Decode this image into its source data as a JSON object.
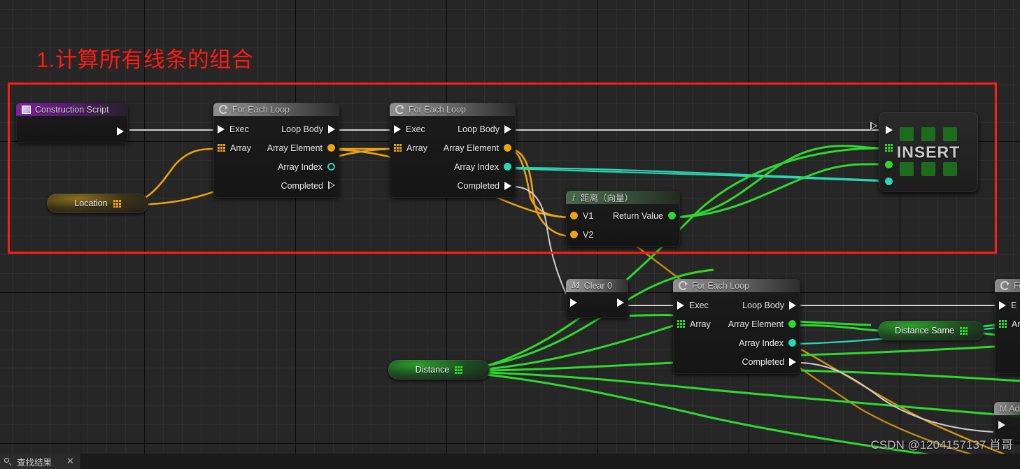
{
  "annotation": {
    "title": "1.计算所有线条的组合",
    "box_color": "#fe1b12"
  },
  "colors": {
    "exec_wire": "#cfcfcf",
    "vector_gold": "#e8a317",
    "float_green": "#2fd82f",
    "int_cyan": "#2bd6b4",
    "red_annotation": "#fe1b12",
    "event_purple": "#7b2399"
  },
  "nodes": {
    "construction_script": {
      "title": "Construction Script",
      "icon": "event-icon",
      "out_exec": ""
    },
    "for_each_loop_1": {
      "title": "For Each Loop",
      "icon": "loop-icon",
      "inputs": [
        {
          "label": "Exec",
          "pin": "exec-pin"
        },
        {
          "label": "Array",
          "pin": "array-pin",
          "color": "#e8a317"
        }
      ],
      "outputs": [
        {
          "label": "Loop Body",
          "pin": "exec-pin"
        },
        {
          "label": "Array Element",
          "pin": "circle-pin",
          "color": "#e8a317"
        },
        {
          "label": "Array Index",
          "pin": "circle-pin-hollow",
          "color": "#2bd6b4"
        },
        {
          "label": "Completed",
          "pin": "exec-pin-hollow"
        }
      ]
    },
    "for_each_loop_2": {
      "title": "For Each Loop",
      "icon": "loop-icon",
      "inputs": [
        {
          "label": "Exec",
          "pin": "exec-pin"
        },
        {
          "label": "Array",
          "pin": "array-pin",
          "color": "#e8a317"
        }
      ],
      "outputs": [
        {
          "label": "Loop Body",
          "pin": "exec-pin"
        },
        {
          "label": "Array Element",
          "pin": "circle-pin",
          "color": "#e8a317"
        },
        {
          "label": "Array Index",
          "pin": "circle-pin",
          "color": "#2bd6b4"
        },
        {
          "label": "Completed",
          "pin": "exec-pin-hollow"
        }
      ]
    },
    "for_each_loop_3": {
      "title": "For Each Loop",
      "icon": "loop-icon",
      "inputs": [
        {
          "label": "Exec",
          "pin": "exec-pin"
        },
        {
          "label": "Array",
          "pin": "array-pin",
          "color": "#2fd82f"
        }
      ],
      "outputs": [
        {
          "label": "Loop Body",
          "pin": "exec-pin"
        },
        {
          "label": "Array Element",
          "pin": "circle-pin",
          "color": "#2fd82f"
        },
        {
          "label": "Array Index",
          "pin": "circle-pin",
          "color": "#2bd6b4"
        },
        {
          "label": "Completed",
          "pin": "exec-pin"
        }
      ]
    },
    "for_each_loop_4_partial": {
      "title": "Fo",
      "icon": "loop-icon",
      "inputs": [
        {
          "label": "E",
          "pin": "exec-pin"
        },
        {
          "label": "Ar",
          "pin": "array-pin",
          "color": "#2fd82f"
        }
      ]
    },
    "distance_vector": {
      "title": "距离（向量）",
      "icon": "function-icon",
      "inputs": [
        {
          "label": "V1",
          "pin": "circle-pin",
          "color": "#e8a317"
        },
        {
          "label": "V2",
          "pin": "circle-pin",
          "color": "#e8a317"
        }
      ],
      "outputs": [
        {
          "label": "Return Value",
          "pin": "circle-pin",
          "color": "#2fd82f"
        }
      ]
    },
    "clear_0": {
      "title": "Clear 0",
      "icon": "macro-icon",
      "in_exec": "",
      "out_exec": ""
    },
    "add_partial": {
      "title": "M Ad",
      "icon": "macro-icon"
    },
    "insert": {
      "label": "INSERT",
      "pins": [
        "exec-in",
        "array-in",
        "float-in",
        "int-in",
        "exec-out"
      ]
    }
  },
  "variables": {
    "location": {
      "label": "Location",
      "pin": "array-pin",
      "color": "#e8a317"
    },
    "distance": {
      "label": "Distance",
      "pin": "array-pin",
      "color": "#2fd82f"
    },
    "distance_same": {
      "label": "Distance Same",
      "pin": "array-pin",
      "color": "#2fd82f"
    }
  },
  "bottom_bar": {
    "find_results_tab": "查找结果",
    "close_label": "✕"
  },
  "watermark": "CSDN @1204157137 肖哥"
}
